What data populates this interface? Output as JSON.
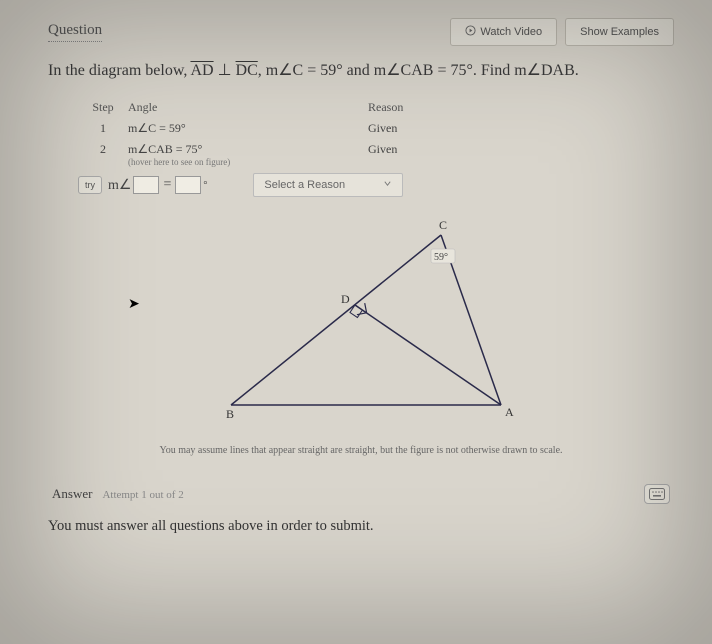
{
  "header": {
    "title": "Question",
    "watch": "Watch Video",
    "examples": "Show Examples"
  },
  "problem": {
    "prefix": "In the diagram below,  ",
    "seg1": "AD",
    "perp": " ⊥ ",
    "seg2": "DC",
    "mid1": ",  m∠C = 59° and m∠CAB = 75°. Find m∠DAB."
  },
  "table": {
    "head_step": "Step",
    "head_angle": "Angle",
    "head_reason": "Reason",
    "rows": [
      {
        "step": "1",
        "angle": "m∠C = 59°",
        "reason": "Given"
      },
      {
        "step": "2",
        "angle": "m∠CAB = 75°",
        "hint": "(hover here to see on figure)",
        "reason": "Given"
      }
    ],
    "try_label": "try",
    "m_prefix": "m∠",
    "eq": "=",
    "deg": "°",
    "select_placeholder": "Select a Reason"
  },
  "figure": {
    "labels": {
      "A": "A",
      "B": "B",
      "C": "C",
      "D": "D",
      "angleC": "59°"
    }
  },
  "note": "You may assume lines that appear straight are straight, but the figure is not otherwise drawn to scale.",
  "answer": {
    "label": "Answer",
    "attempt": "Attempt 1 out of 2"
  },
  "submit_msg": "You must answer all questions above in order to submit.",
  "chart_data": {
    "type": "diagram",
    "description": "Triangle ABC with altitude AD from A to BC. D lies on segment BC between B and C. AD ⟂ DC (right angle at D).",
    "points": [
      "A",
      "B",
      "C",
      "D"
    ],
    "segments": [
      "AB",
      "BC",
      "CA",
      "AD"
    ],
    "right_angle_at": "D",
    "given_angles": {
      "C": 59,
      "CAB": 75
    },
    "find": "DAB"
  }
}
